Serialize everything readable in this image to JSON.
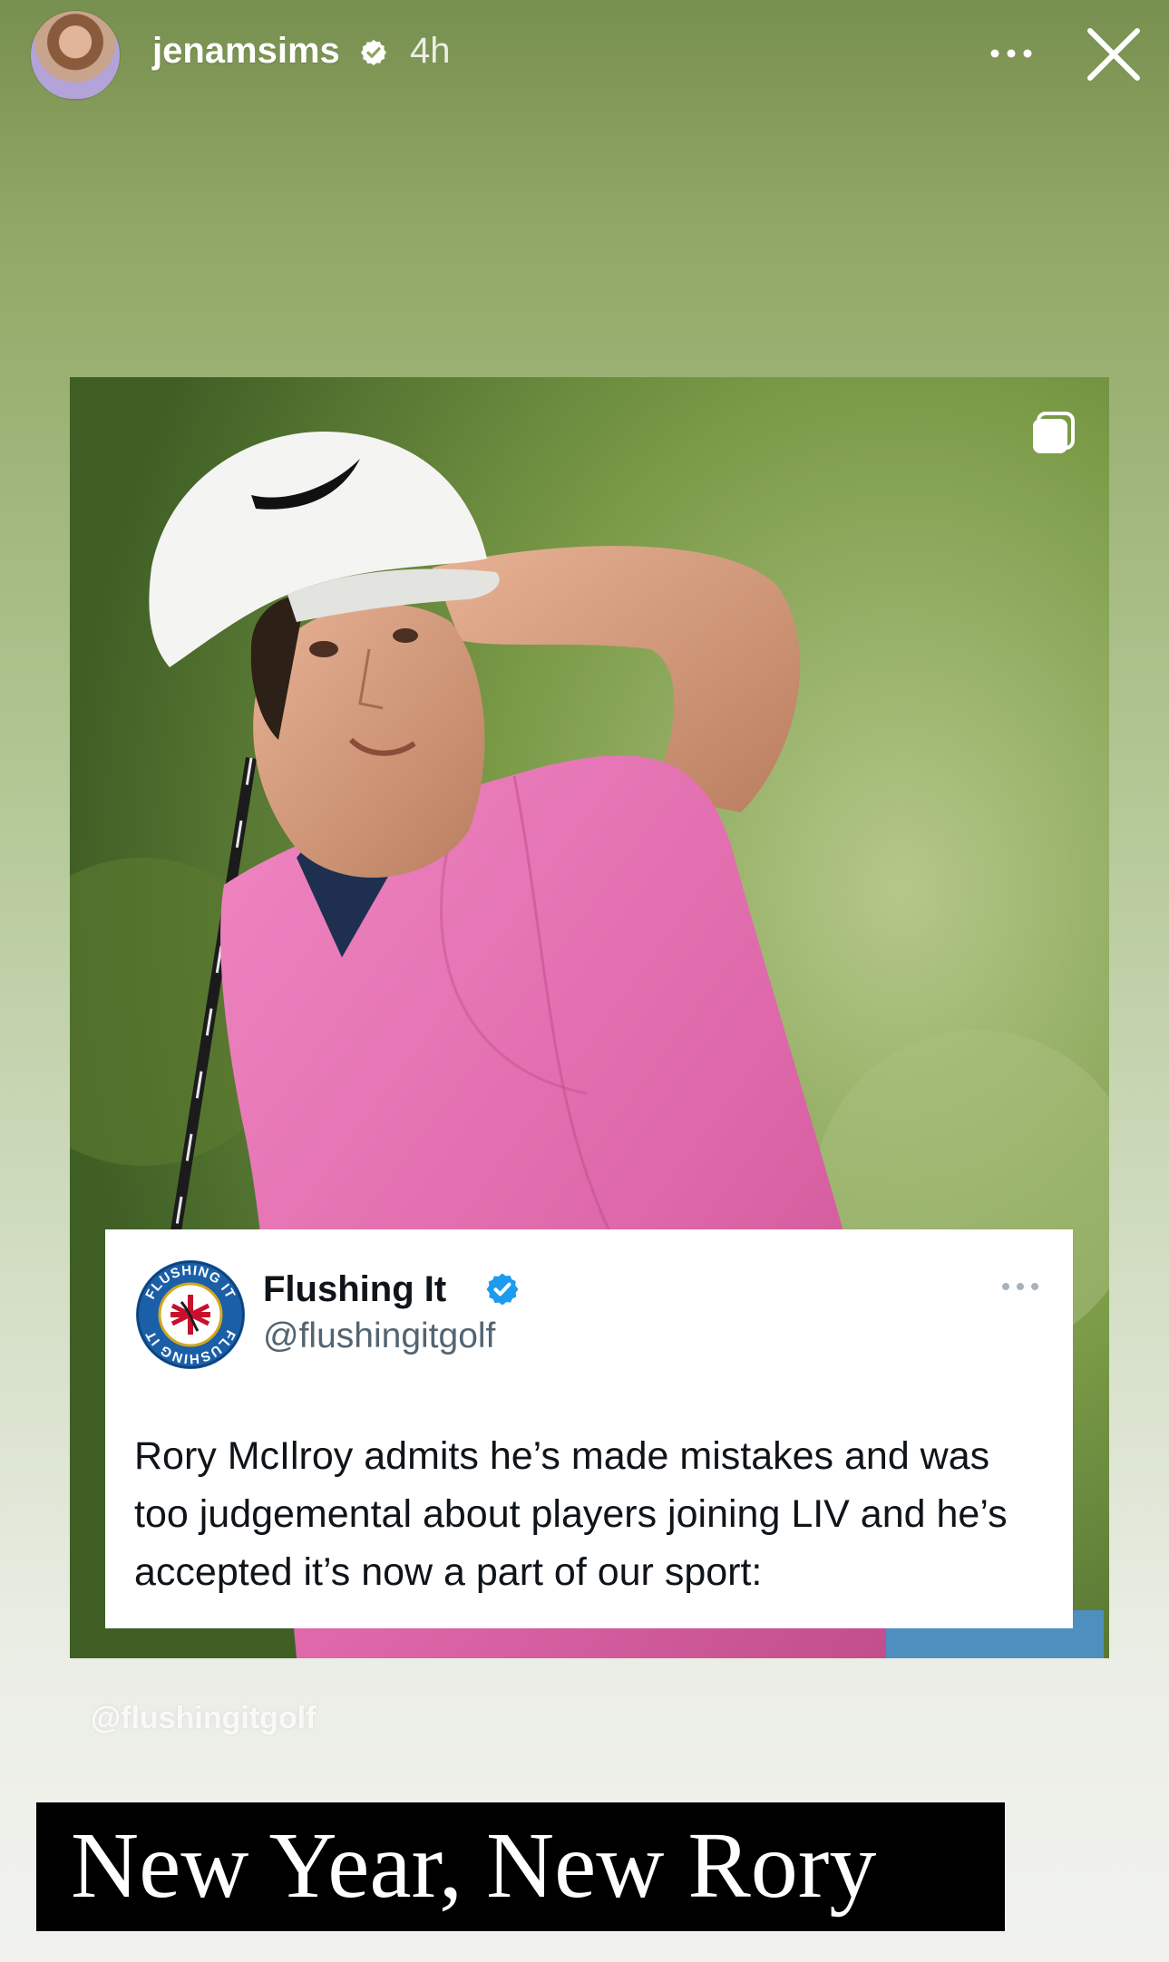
{
  "story": {
    "username": "jenamsims",
    "time_ago": "4h",
    "mention": "@flushingitgolf",
    "caption": "New Year, New Rory"
  },
  "tweet": {
    "name": "Flushing It",
    "handle": "@flushingitgolf",
    "text": "Rory McIlroy admits he’s made mistakes and was too judgemental about players joining LIV and he’s accepted it’s now a part of our sport:",
    "logo": {
      "top_text": "FLUSHING IT",
      "bottom_text": "FLUSHING IT"
    }
  },
  "colors": {
    "verified_blue": "#1d9bf0",
    "tweet_text": "#0f1419",
    "handle_gray": "#536471",
    "shirt_pink": "#e56fb0",
    "cap_white": "#f4f4f2"
  },
  "icons": {
    "verified": "verified-badge-icon",
    "more": "more-horizontal-icon",
    "close": "close-icon",
    "carousel": "carousel-icon"
  }
}
